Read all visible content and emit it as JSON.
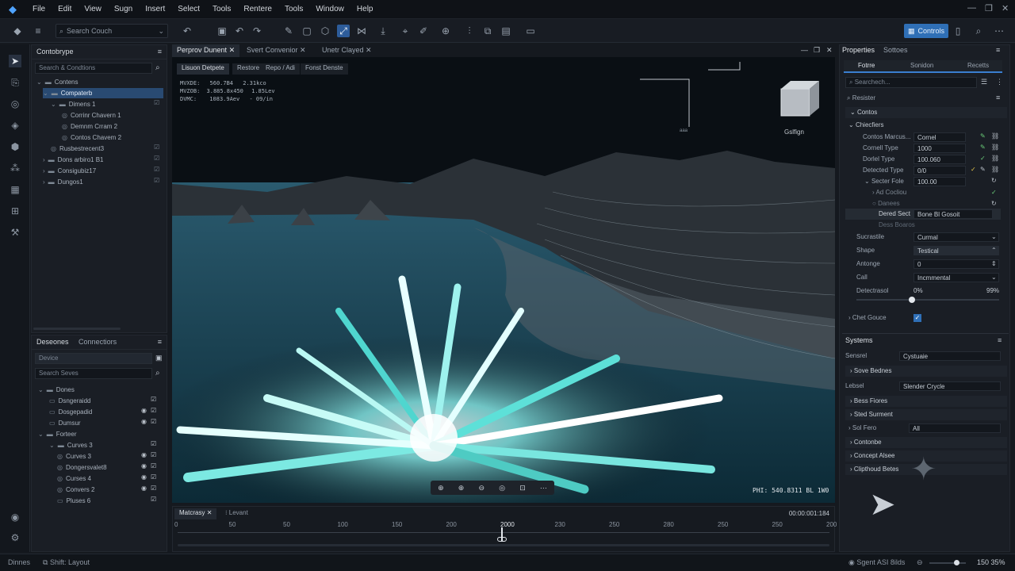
{
  "menu": [
    "File",
    "Edit",
    "View",
    "Sugn",
    "Insert",
    "Select",
    "Tools",
    "Rentere",
    "Tools",
    "Window",
    "Help"
  ],
  "toolbar": {
    "search_placeholder": "Search Couch",
    "primary_button": "Controls"
  },
  "left_top_panel": {
    "title": "Contobrype",
    "search": "Search & Condtions",
    "tree": [
      "Contens",
      "Compaterb",
      "Dimens 1",
      "Corrinr Chavern 1",
      "Demnm Crram 2",
      "Contos Chavem 2",
      "Rusbestrecent3",
      "Dons arbiro1 B1",
      "Consigubiz17",
      "Dungos1"
    ]
  },
  "left_bottom_panel": {
    "tabs": [
      "Deseones",
      "Connectiors"
    ],
    "field1": "Device",
    "search": "Search Seves",
    "tree": [
      "Dones",
      "Dsngeraidd",
      "Dosgepadid",
      "Dumsur",
      "Forteer",
      "Curves 3",
      "Curves 3",
      "Dongersvalet8",
      "Curses 4",
      "Convers 2",
      "Pluses 6"
    ]
  },
  "viewport": {
    "tabs": [
      "Perprov Dunent",
      "Svert Convenior",
      "Unetr Clayed"
    ],
    "subtabs": [
      "Lisuon Detpete",
      "Restore",
      "Repo / Adi",
      "Fonst Denste"
    ],
    "stats": [
      [
        "MVXDE:",
        "560.7B4",
        "2.31kco"
      ],
      [
        "MVZOB:",
        "3.885.8x450",
        "1.85Lev"
      ],
      [
        "DVMC:",
        "1083.9Aev",
        "- 09/in"
      ]
    ],
    "cube_label": "Gslfign",
    "corner_label": "aaa",
    "readout": "PHI: 540.8311 BL 1W0"
  },
  "properties": {
    "tabs": [
      "Properties",
      "Sottoes"
    ],
    "subtabs": [
      "Fotrre",
      "Sonidon",
      "Recetts"
    ],
    "search": "Searchech...",
    "filter": "Resister",
    "section1": "Contos",
    "group": "Chiecfiers",
    "rows": [
      [
        "Contos Marcus...",
        "Cornel"
      ],
      [
        "Cornell Type",
        "1000"
      ],
      [
        "Dorlel Type",
        "100.060"
      ],
      [
        "Detected Type",
        "0/0"
      ],
      [
        "Secter Fole",
        "100.00"
      ],
      [
        "Ad Cocliou",
        ""
      ],
      [
        "Danees",
        ""
      ],
      [
        "Dered Sect",
        "Bone Bl Gosoit"
      ],
      [
        "Dess Boaros",
        ""
      ]
    ],
    "rows2": [
      [
        "Sucrastile",
        "Curmal"
      ],
      [
        "Shape",
        "Testical"
      ],
      [
        "Antonge",
        "0"
      ],
      [
        "Call",
        "Incmmental"
      ],
      [
        "Detectrasol",
        "0%"
      ]
    ],
    "slider_right": "99%",
    "checkbox_label": "Chet Gouce",
    "section2": "Systems",
    "sys_rows": [
      [
        "Sensrel",
        "Cystuaie"
      ],
      [
        "Lebsel",
        "Slender Crycle"
      ],
      [
        "Sol Fero",
        "All"
      ]
    ],
    "sys_sections": [
      "Sove Bednes",
      "Bess Fiores",
      "Sted Surment",
      "Contonbe",
      "Concept Alsee",
      "Clipthoud Betes"
    ]
  },
  "timeline": {
    "tab": "Matcrasy",
    "tab2": "Levant",
    "ticks": [
      "0",
      "50",
      "50",
      "100",
      "150",
      "200",
      "2000",
      "230",
      "250",
      "280",
      "250",
      "250",
      "200"
    ],
    "time": "00:00:001:184"
  },
  "status": {
    "left": "Dinnes",
    "left2": "Shift: Layout",
    "right1": "Sgent ASI 8ilds",
    "zoom": "150 35%"
  }
}
